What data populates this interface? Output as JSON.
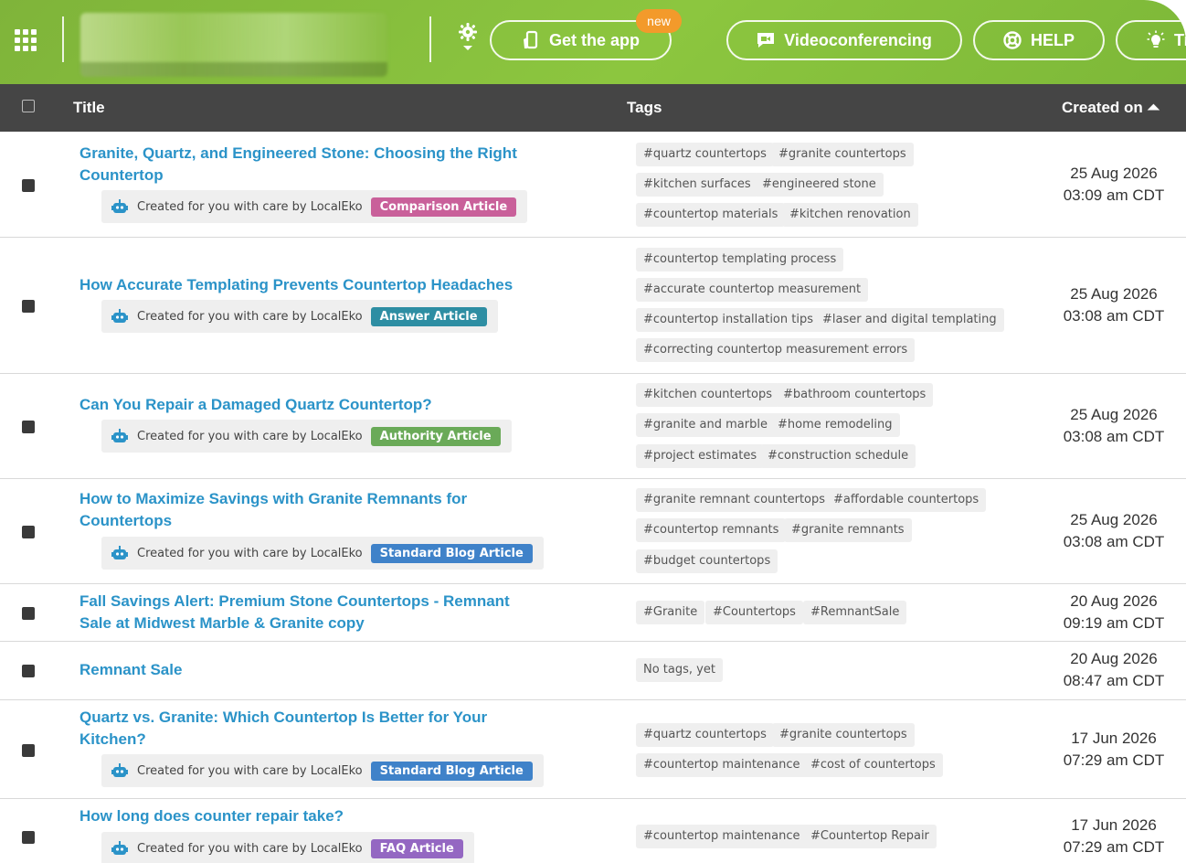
{
  "topbar": {
    "get_app_label": "Get the app",
    "new_badge": "new",
    "video_label": "Videoconferencing",
    "help_label": "HELP",
    "tips_label": "Ti",
    "accent": "#8cc63f",
    "badge_color": "#f39a2b"
  },
  "table": {
    "col_title": "Title",
    "col_tags": "Tags",
    "col_created": "Created on ⏶"
  },
  "credit_text": "Created for you with care by LocalEko",
  "colors": {
    "title_link": "#2b93c8",
    "header_bg": "#454545",
    "comparison": "#c9609a",
    "answer": "#2e8ea3",
    "authority": "#6aaa58",
    "standard": "#3f82c9",
    "faq": "#9467c2"
  },
  "rows": [
    {
      "title": "Granite, Quartz, and Engineered Stone: Choosing the Right Countertop",
      "article_type": "Comparison Article",
      "tags": [
        "#quartz countertops",
        "#granite countertops",
        "#kitchen surfaces",
        "#engineered stone",
        "#countertop materials",
        "#kitchen renovation"
      ],
      "date": "25 Aug 2026",
      "time": "03:09 am CDT"
    },
    {
      "title": "How Accurate Templating Prevents Countertop Headaches",
      "article_type": "Answer Article",
      "tags": [
        "#countertop templating process",
        "#accurate countertop measurement",
        "#countertop installation tips",
        "#laser and digital templating",
        "#correcting countertop measurement errors"
      ],
      "date": "25 Aug 2026",
      "time": "03:08 am CDT"
    },
    {
      "title": "Can You Repair a Damaged Quartz Countertop?",
      "article_type": "Authority Article",
      "tags": [
        "#kitchen countertops",
        "#bathroom countertops",
        "#granite and marble",
        "#home remodeling",
        "#project estimates",
        "#construction schedule"
      ],
      "date": "25 Aug 2026",
      "time": "03:08 am CDT"
    },
    {
      "title": "How to Maximize Savings with Granite Remnants for Countertops",
      "article_type": "Standard Blog Article",
      "tags": [
        "#granite remnant countertops",
        "#affordable countertops",
        "#countertop remnants",
        "#granite remnants",
        "#budget countertops"
      ],
      "date": "25 Aug 2026",
      "time": "03:08 am CDT"
    },
    {
      "title": "Fall Savings Alert: Premium Stone Countertops - Remnant Sale at Midwest Marble & Granite copy",
      "tags": [
        "#Granite",
        "#Countertops",
        "#RemnantSale"
      ],
      "date": "20 Aug 2026",
      "time": "09:19 am CDT"
    },
    {
      "title": "Remnant Sale",
      "tags": [
        "No tags, yet"
      ],
      "date": "20 Aug 2026",
      "time": "08:47 am CDT"
    },
    {
      "title": "Quartz vs. Granite: Which Countertop Is Better for Your Kitchen?",
      "article_type": "Standard Blog Article",
      "tags": [
        "#quartz countertops",
        "#granite countertops",
        "#countertop maintenance",
        "#cost of countertops"
      ],
      "date": "17 Jun 2026",
      "time": "07:29 am CDT"
    },
    {
      "title": "How long does counter repair take?",
      "article_type": "FAQ Article",
      "tags": [
        "#countertop maintenance",
        "#Countertop Repair"
      ],
      "date": "17 Jun 2026",
      "time": "07:29 am CDT"
    }
  ]
}
